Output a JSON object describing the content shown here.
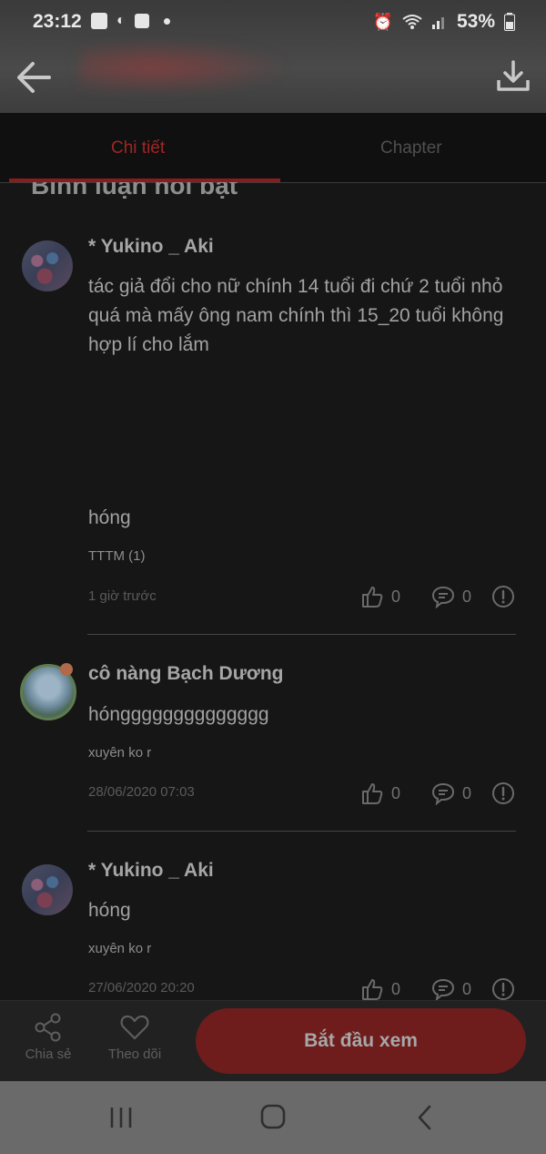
{
  "status_bar": {
    "time": "23:12",
    "battery": "53%",
    "icons": [
      "gallery-icon",
      "moon-icon",
      "facebook-icon",
      "notification-dot-icon",
      "alarm-icon",
      "wifi-icon",
      "signal-icon",
      "battery-icon"
    ]
  },
  "app_bar": {
    "back_icon": "arrow-left-icon",
    "download_icon": "download-icon"
  },
  "tabs": [
    {
      "label": "Chi tiết",
      "active": true
    },
    {
      "label": "Chapter",
      "active": false
    }
  ],
  "section_title": "Bình luận nổi bật",
  "comments": [
    {
      "user": "* Yukino _ Aki",
      "text": "tác giả đổi cho nữ chính 14 tuổi đi chứ 2 tuổi nhỏ quá mà mấy ông nam chính thì 15_20 tuổi không hợp lí cho lắm",
      "extra": "hóng",
      "reply": "TTTM (1)",
      "time": "1 giờ trước",
      "likes": "0",
      "replies": "0"
    },
    {
      "user": "cô nàng Bạch Dương",
      "text": "hóngggggggggggggg",
      "reply": "xuyên ko r",
      "time": "28/06/2020 07:03",
      "likes": "0",
      "replies": "0"
    },
    {
      "user": "* Yukino _ Aki",
      "text": "hóng",
      "reply": "xuyên ko r",
      "time": "27/06/2020 20:20",
      "likes": "0",
      "replies": "0"
    }
  ],
  "bottom_bar": {
    "share_label": "Chia sẻ",
    "follow_label": "Theo dõi",
    "start_label": "Bắt đầu xem"
  },
  "colors": {
    "accent": "#a12525",
    "start_button": "#6e1c1c",
    "background": "#161616"
  }
}
